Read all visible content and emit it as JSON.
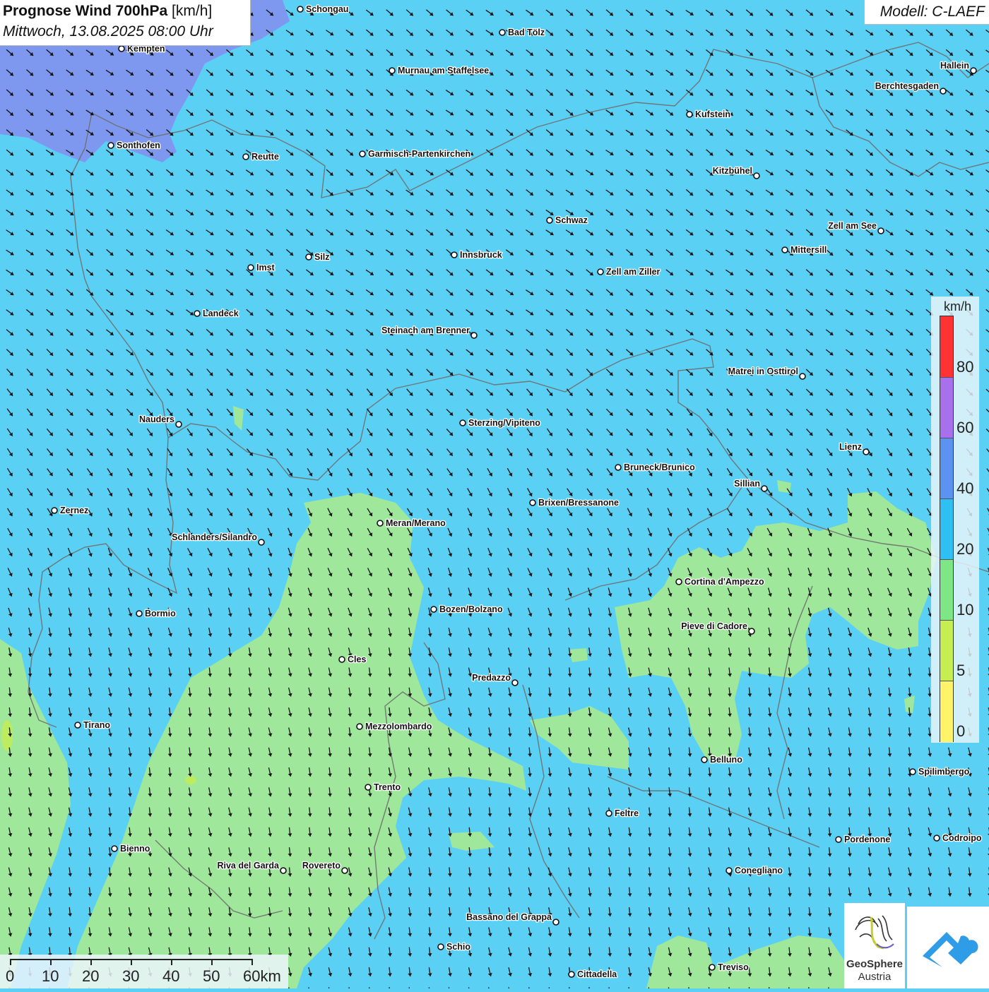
{
  "header": {
    "title_bold": "Prognose Wind 700hPa",
    "title_unit": "[km/h]",
    "datetime": "Mittwoch, 13.08.2025 08:00 Uhr",
    "model": "Modell: C-LAEF"
  },
  "legend": {
    "unit": "km/h",
    "ticks": [
      "80",
      "60",
      "40",
      "20",
      "10",
      "5",
      "0"
    ],
    "colors": [
      "#ff3333",
      "#a970ee",
      "#5c93f2",
      "#2fc0f3",
      "#7ee684",
      "#c6ee52",
      "#fff36a"
    ]
  },
  "scale_bar": {
    "labels": [
      "0",
      "10",
      "20",
      "30",
      "40",
      "50",
      "60km"
    ]
  },
  "logos": {
    "geosphere_line1": "GeoSphere",
    "geosphere_line2": "Austria"
  },
  "colors": {
    "calm_green": "#9fe79a",
    "wind_blue": "#5bd0f5",
    "strong_blue": "#7e98ef",
    "border_gray": "#6e6e6e",
    "arrow": "#111111"
  },
  "cities": [
    {
      "name": "Schongau",
      "side": "right"
    },
    {
      "name": "Bad Tölz",
      "side": "right"
    },
    {
      "name": "Kempten",
      "side": "right"
    },
    {
      "name": "Murnau am Staffelsee",
      "side": "right"
    },
    {
      "name": "Hallein",
      "side": "left"
    },
    {
      "name": "Berchtesgaden",
      "side": "left"
    },
    {
      "name": "Kufstein",
      "side": "right"
    },
    {
      "name": "Sonthofen",
      "side": "right"
    },
    {
      "name": "Reutte",
      "side": "right"
    },
    {
      "name": "Garmisch-Partenkirchen",
      "side": "right"
    },
    {
      "name": "Kitzbühel",
      "side": "left"
    },
    {
      "name": "Schwaz",
      "side": "right"
    },
    {
      "name": "Zell am See",
      "side": "left"
    },
    {
      "name": "Mittersill",
      "side": "right"
    },
    {
      "name": "Silz",
      "side": "right"
    },
    {
      "name": "Innsbruck",
      "side": "right"
    },
    {
      "name": "Imst",
      "side": "right"
    },
    {
      "name": "Zell am Ziller",
      "side": "right"
    },
    {
      "name": "Landeck",
      "side": "right"
    },
    {
      "name": "Steinach am Brenner",
      "side": "left"
    },
    {
      "name": "Matrei in Osttirol",
      "side": "left"
    },
    {
      "name": "Nauders",
      "side": "left"
    },
    {
      "name": "Sterzing/Vipiteno",
      "side": "right"
    },
    {
      "name": "Lienz",
      "side": "left"
    },
    {
      "name": "Bruneck/Brunico",
      "side": "right"
    },
    {
      "name": "Sillian",
      "side": "left"
    },
    {
      "name": "Brixen/Bressanone",
      "side": "right"
    },
    {
      "name": "Zernez",
      "side": "right"
    },
    {
      "name": "Meran/Merano",
      "side": "right"
    },
    {
      "name": "Schlanders/Silandro",
      "side": "left"
    },
    {
      "name": "Cortina d'Ampezzo",
      "side": "right"
    },
    {
      "name": "Bozen/Bolzano",
      "side": "right"
    },
    {
      "name": "Bormio",
      "side": "right"
    },
    {
      "name": "Pieve di Cadore",
      "side": "left"
    },
    {
      "name": "Cles",
      "side": "right"
    },
    {
      "name": "Predazzo",
      "side": "left"
    },
    {
      "name": "Tirano",
      "side": "right"
    },
    {
      "name": "Mezzolombardo",
      "side": "right"
    },
    {
      "name": "Belluno",
      "side": "right"
    },
    {
      "name": "Spilimbergo",
      "side": "right"
    },
    {
      "name": "Trento",
      "side": "right"
    },
    {
      "name": "Feltre",
      "side": "right"
    },
    {
      "name": "Pordenone",
      "side": "right"
    },
    {
      "name": "Codroipo",
      "side": "right"
    },
    {
      "name": "Bienno",
      "side": "right"
    },
    {
      "name": "Riva del Garda",
      "side": "left"
    },
    {
      "name": "Rovereto",
      "side": "left"
    },
    {
      "name": "Conegliano",
      "side": "right"
    },
    {
      "name": "Bassano del Grappa",
      "side": "left"
    },
    {
      "name": "Schio",
      "side": "right"
    },
    {
      "name": "Treviso",
      "side": "right"
    },
    {
      "name": "Cittadella",
      "side": "right"
    }
  ]
}
